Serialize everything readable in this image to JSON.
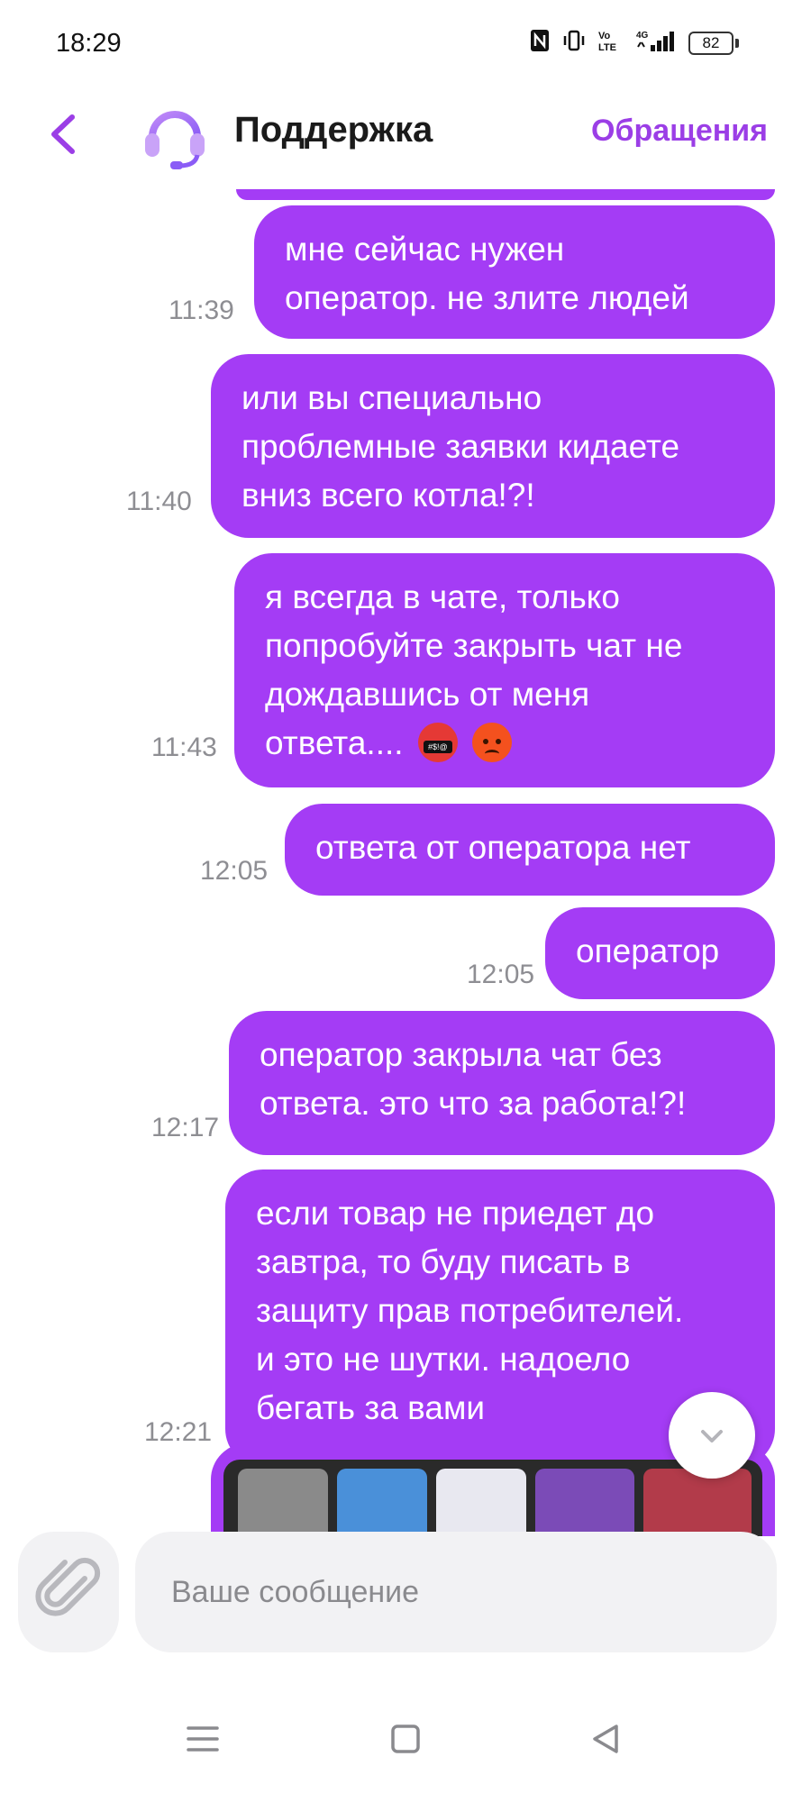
{
  "status": {
    "time": "18:29",
    "battery": "82"
  },
  "header": {
    "title": "Поддержка",
    "appeals_label": "Обращения"
  },
  "messages": [
    {
      "lines": [
        "мне сейчас нужен",
        "оператор. не злите людей"
      ],
      "time": "11:39"
    },
    {
      "lines": [
        "или вы специально",
        "проблемные заявки кидаете",
        "вниз всего котла!?!"
      ],
      "time": "11:40"
    },
    {
      "lines": [
        "я всегда в чате, только",
        "попробуйте закрыть чат не",
        "дождавшись от меня",
        "ответа...."
      ],
      "time": "11:43"
    },
    {
      "lines": [
        "ответа от оператора нет"
      ],
      "time": "12:05"
    },
    {
      "lines": [
        "оператор"
      ],
      "time": "12:05"
    },
    {
      "lines": [
        "оператор закрыла чат без",
        "ответа. это что за работа!?!"
      ],
      "time": "12:17"
    },
    {
      "lines": [
        "если товар не приедет до",
        "завтра, то буду писать в",
        "защиту прав потребителей.",
        "и это не шутки. надоело",
        "бегать за вами"
      ],
      "time": "12:21"
    }
  ],
  "emoji_names": [
    "swearing-face-emoji",
    "angry-face-emoji"
  ],
  "composer": {
    "placeholder": "Ваше сообщение"
  },
  "colors": {
    "accent": "#a43cf5",
    "link": "#9b3ee6",
    "time_gray": "#8e8e93",
    "input_bg": "#f2f2f4"
  },
  "icons": [
    "back-chevron-icon",
    "headset-icon",
    "chevron-down-icon",
    "paperclip-icon",
    "menu-icon",
    "home-square-icon",
    "back-triangle-icon"
  ]
}
